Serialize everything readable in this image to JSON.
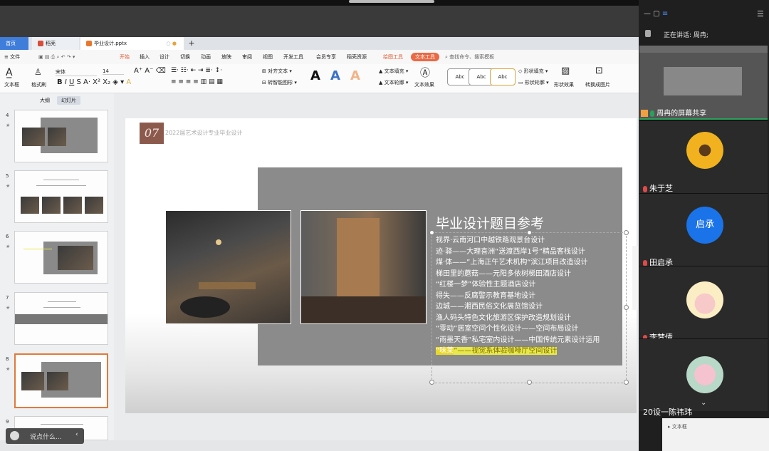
{
  "tabs": {
    "home": "首页",
    "docer": "稻壳",
    "doc": "毕业设计.pptx"
  },
  "menu": {
    "file": "文件",
    "items": [
      "开始",
      "插入",
      "设计",
      "切换",
      "动画",
      "放映",
      "审阅",
      "视图",
      "开发工具",
      "会员专享",
      "稻壳资源"
    ],
    "drawing_tools": "绘图工具",
    "text_tools": "文本工具",
    "search": "查找命令、搜索模板"
  },
  "ribbon": {
    "textbox": "文本框",
    "format_painter": "格式刷",
    "font_name": "宋体",
    "font_size": "14",
    "align_text": "对齐文本",
    "smart_shape": "转智能图形",
    "text_fill": "文本填充",
    "text_outline": "文本轮廓",
    "text_effect": "文本效果",
    "abc": "Abc",
    "shape_fill": "形状填充",
    "shape_outline": "形状轮廓",
    "shape_effect": "形状效果",
    "convert_image": "转换成图片"
  },
  "left_panel": {
    "outline_tab": "大纲",
    "slides_tab": "幻灯片",
    "slide_numbers": [
      "4",
      "5",
      "6",
      "7",
      "8",
      "9"
    ]
  },
  "slide": {
    "number": "07",
    "header": "2022届艺术设计专业毕业设计",
    "title": "毕业设计题目参考",
    "items": [
      "视界·云南河口中越铁路观景台设计",
      "迹·驿——大理喜洲“送渡西岸1号”精品客栈设计",
      "煤·体——”上海正午艺术机构“滨江项目改造设计",
      "梯田里的蘑菇——元阳多依树梯田酒店设计",
      "“红楼一梦”体验性主题酒店设计",
      "得失——反腐警示教育基地设计",
      "边城——湘西民俗文化展览馆设计",
      "渔人码头特色文化旅游区保护改造规划设计",
      "“零动”居室空间个性化设计——空间布局设计",
      "“雨墨天香”私宅室内设计——中国传统元素设计运用"
    ],
    "highlighted_item_start": "“味莱",
    "highlighted_item_rest": "”——视觉系体验咖啡厅空间设计"
  },
  "bottom": {
    "say_something": "说点什么...",
    "textbox_label": "文本框"
  },
  "meeting": {
    "speaking": "正在讲话: 周冉;",
    "screen_share": "周冉的屏幕共享",
    "participants": [
      {
        "name": "朱于芝"
      },
      {
        "name": "田启承",
        "initials": "启承"
      },
      {
        "name": "李梦倩"
      },
      {
        "name": "20设一陈祎玮"
      }
    ]
  },
  "colors": {
    "accent_orange": "#e96a45",
    "slide_number_box": "#8c5a4d",
    "highlight": "#e8e84a",
    "avatar_blue": "#1a73e8"
  }
}
